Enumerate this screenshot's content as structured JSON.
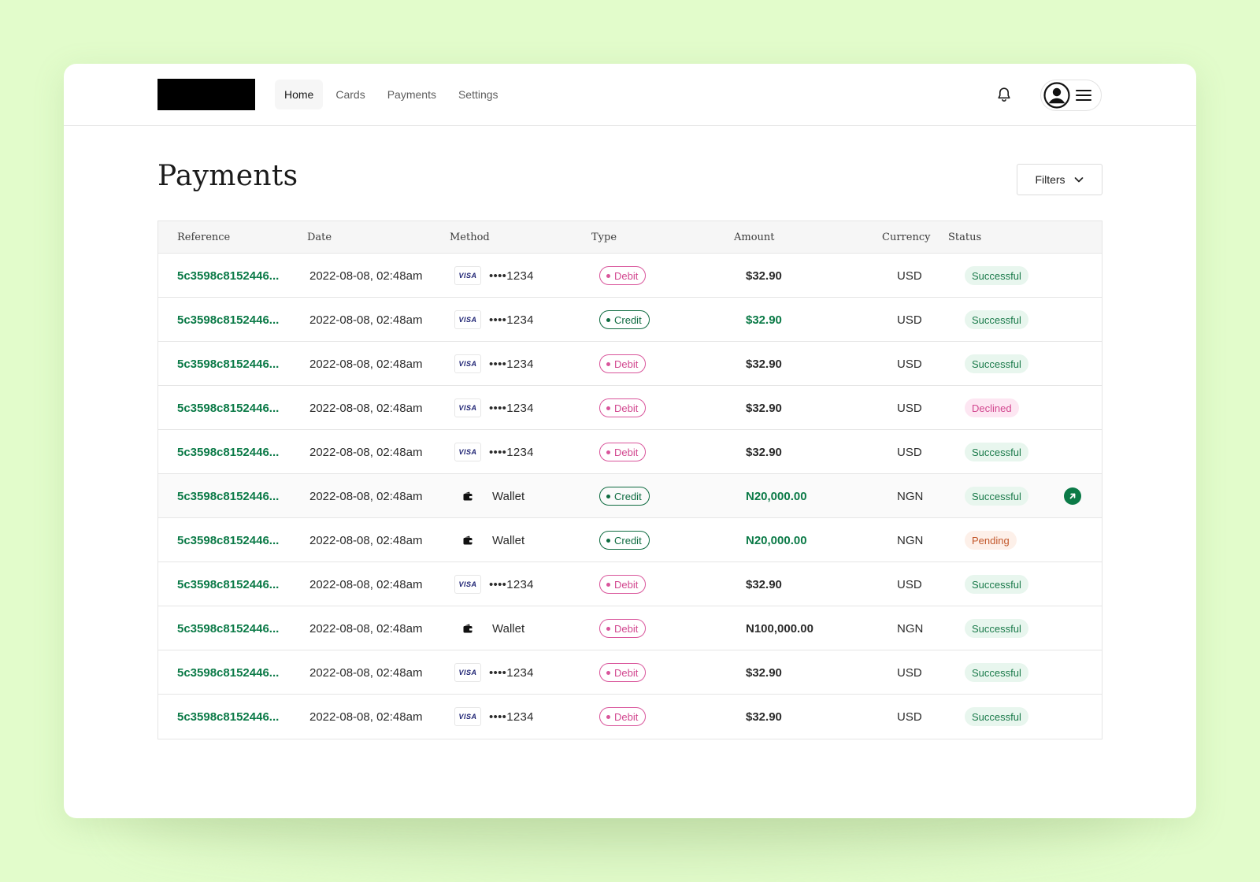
{
  "nav": {
    "items": [
      {
        "label": "Home",
        "active": true
      },
      {
        "label": "Cards",
        "active": false
      },
      {
        "label": "Payments",
        "active": false
      },
      {
        "label": "Settings",
        "active": false
      }
    ]
  },
  "icons": {
    "bell": "bell-icon",
    "avatar": "user-avatar-icon",
    "menu": "hamburger-menu-icon",
    "wallet": "wallet-icon",
    "arrow": "arrow-up-right-icon"
  },
  "page": {
    "title": "Payments",
    "filters_label": "Filters"
  },
  "table": {
    "columns": [
      "Reference",
      "Date",
      "Method",
      "Type",
      "Amount",
      "Currency",
      "Status"
    ],
    "rows": [
      {
        "reference": "5c3598c8152446...",
        "date": "2022-08-08, 02:48am",
        "method_type": "visa",
        "method_brand": "VISA",
        "method_label": "••••1234",
        "type": "Debit",
        "amount": "$32.90",
        "currency": "USD",
        "status": "Successful"
      },
      {
        "reference": "5c3598c8152446...",
        "date": "2022-08-08, 02:48am",
        "method_type": "visa",
        "method_brand": "VISA",
        "method_label": "••••1234",
        "type": "Credit",
        "amount": "$32.90",
        "currency": "USD",
        "status": "Successful"
      },
      {
        "reference": "5c3598c8152446...",
        "date": "2022-08-08, 02:48am",
        "method_type": "visa",
        "method_brand": "VISA",
        "method_label": "••••1234",
        "type": "Debit",
        "amount": "$32.90",
        "currency": "USD",
        "status": "Successful"
      },
      {
        "reference": "5c3598c8152446...",
        "date": "2022-08-08, 02:48am",
        "method_type": "visa",
        "method_brand": "VISA",
        "method_label": "••••1234",
        "type": "Debit",
        "amount": "$32.90",
        "currency": "USD",
        "status": "Declined"
      },
      {
        "reference": "5c3598c8152446...",
        "date": "2022-08-08, 02:48am",
        "method_type": "visa",
        "method_brand": "VISA",
        "method_label": "••••1234",
        "type": "Debit",
        "amount": "$32.90",
        "currency": "USD",
        "status": "Successful"
      },
      {
        "reference": "5c3598c8152446...",
        "date": "2022-08-08, 02:48am",
        "method_type": "wallet",
        "method_brand": "",
        "method_label": "Wallet",
        "type": "Credit",
        "amount": "N20,000.00",
        "currency": "NGN",
        "status": "Successful",
        "hovered": true
      },
      {
        "reference": "5c3598c8152446...",
        "date": "2022-08-08, 02:48am",
        "method_type": "wallet",
        "method_brand": "",
        "method_label": "Wallet",
        "type": "Credit",
        "amount": "N20,000.00",
        "currency": "NGN",
        "status": "Pending"
      },
      {
        "reference": "5c3598c8152446...",
        "date": "2022-08-08, 02:48am",
        "method_type": "visa",
        "method_brand": "VISA",
        "method_label": "••••1234",
        "type": "Debit",
        "amount": "$32.90",
        "currency": "USD",
        "status": "Successful"
      },
      {
        "reference": "5c3598c8152446...",
        "date": "2022-08-08, 02:48am",
        "method_type": "wallet",
        "method_brand": "",
        "method_label": "Wallet",
        "type": "Debit",
        "amount": "N100,000.00",
        "currency": "NGN",
        "status": "Successful"
      },
      {
        "reference": "5c3598c8152446...",
        "date": "2022-08-08, 02:48am",
        "method_type": "visa",
        "method_brand": "VISA",
        "method_label": "••••1234",
        "type": "Debit",
        "amount": "$32.90",
        "currency": "USD",
        "status": "Successful"
      },
      {
        "reference": "5c3598c8152446...",
        "date": "2022-08-08, 02:48am",
        "method_type": "visa",
        "method_brand": "VISA",
        "method_label": "••••1234",
        "type": "Debit",
        "amount": "$32.90",
        "currency": "USD",
        "status": "Successful"
      }
    ]
  },
  "colors": {
    "background": "#e2fccb",
    "brand_green": "#0b7a47",
    "debit_pink": "#d9559b",
    "credit_green": "#0e6b40",
    "pending_orange": "#c2572a"
  }
}
